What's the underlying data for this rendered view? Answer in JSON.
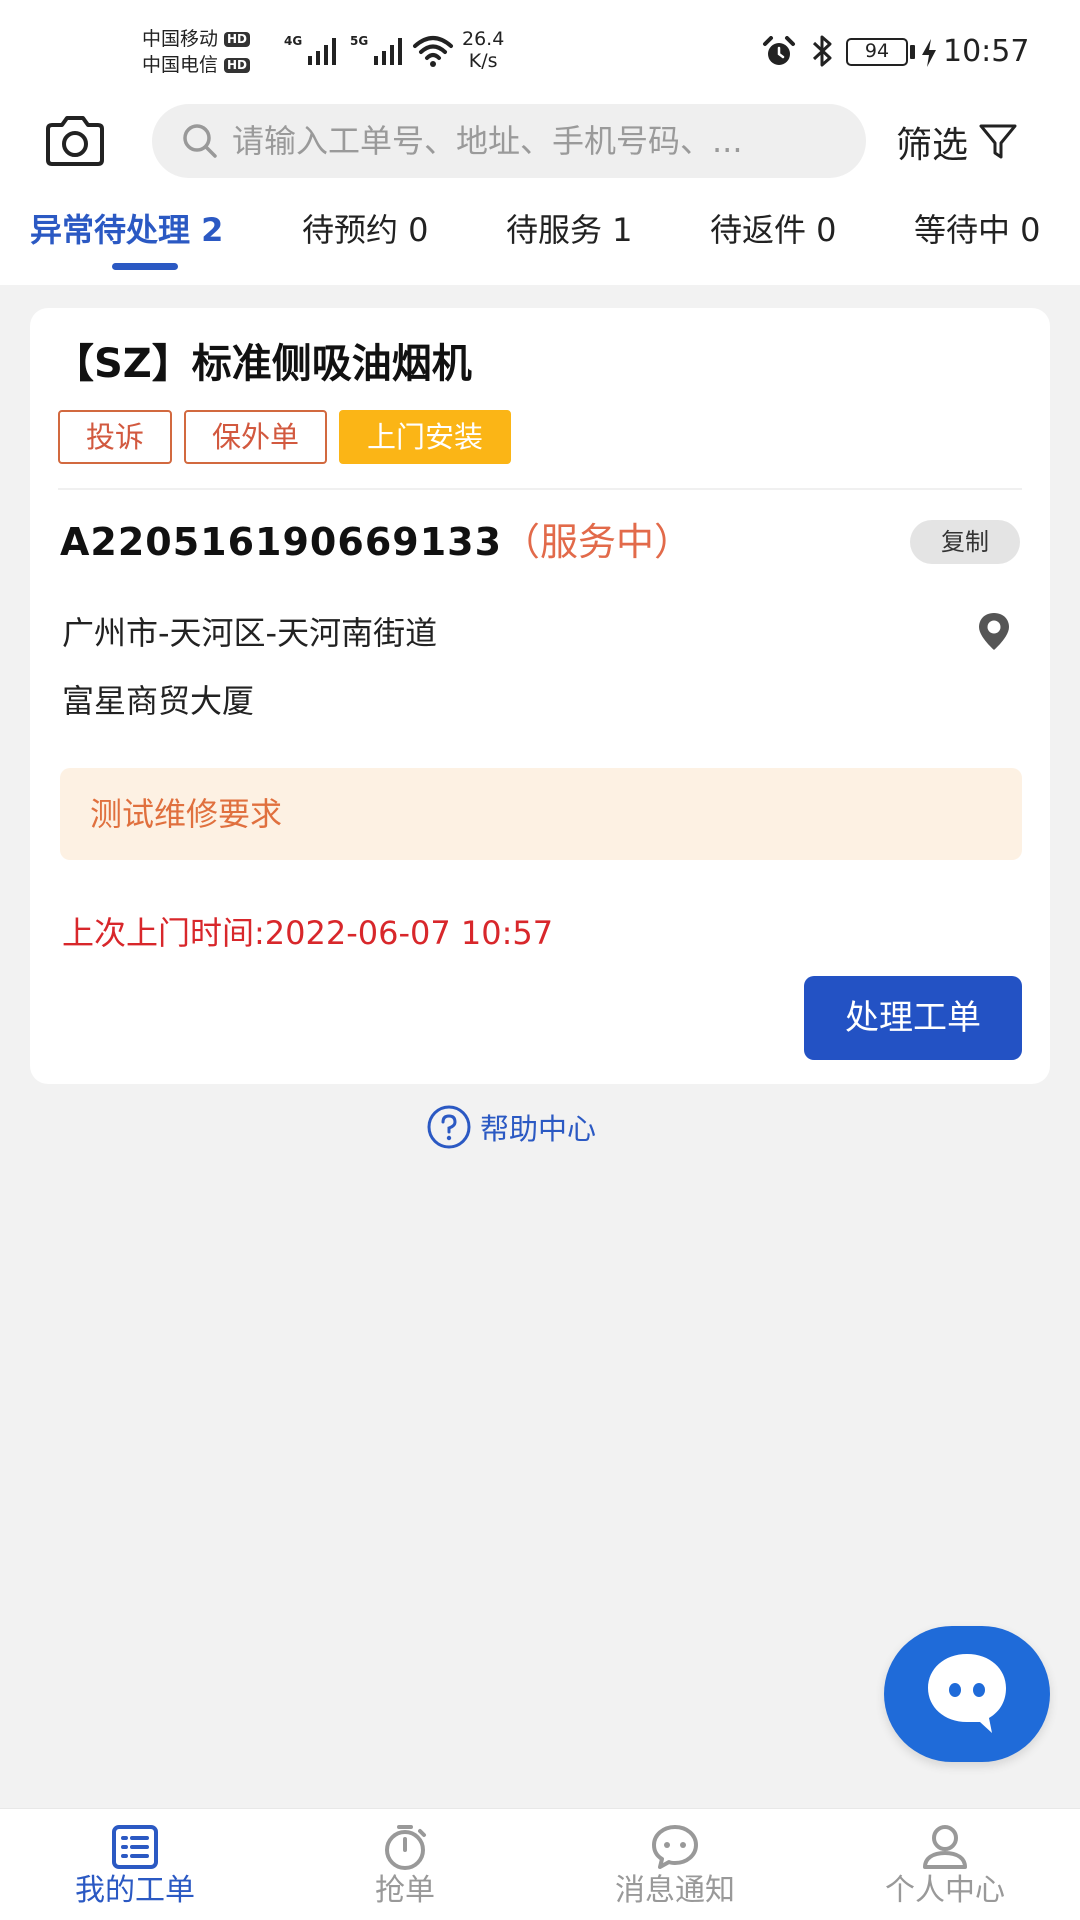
{
  "status_bar": {
    "carrier1": "中国移动",
    "carrier2": "中国电信",
    "hd": "HD",
    "sig1_label": "4G",
    "sig2_label": "5G",
    "net_speed_value": "26.4",
    "net_speed_unit": "K/s",
    "battery": "94",
    "time": "10:57"
  },
  "header": {
    "search_placeholder": "请输入工单号、地址、手机号码、...",
    "filter_label": "筛选"
  },
  "tabs": [
    {
      "label": "异常待处理 2",
      "active": true
    },
    {
      "label": "待预约 0",
      "active": false
    },
    {
      "label": "待服务 1",
      "active": false
    },
    {
      "label": "待返件 0",
      "active": false
    },
    {
      "label": "等待中 0",
      "active": false
    }
  ],
  "order_card": {
    "title": "【SZ】标准侧吸油烟机",
    "tags": [
      "投诉",
      "保外单",
      "上门安装"
    ],
    "order_no": "A220516190669133",
    "status": "（服务中）",
    "copy_label": "复制",
    "address_line1": "广州市-天河区-天河南街道",
    "address_line2": "富星商贸大厦",
    "note": "测试维修要求",
    "last_visit": "上次上门时间:2022-06-07 10:57",
    "action_label": "处理工单"
  },
  "help_label": "帮助中心",
  "bottom_nav": [
    {
      "label": "我的工单",
      "icon": "list-icon",
      "active": true
    },
    {
      "label": "抢单",
      "icon": "timer-icon",
      "active": false
    },
    {
      "label": "消息通知",
      "icon": "message-icon",
      "active": false
    },
    {
      "label": "个人中心",
      "icon": "user-icon",
      "active": false
    }
  ],
  "colors": {
    "primary": "#2352c4",
    "tab_active": "#2b59c3",
    "tag_border": "#d2693f",
    "tag_filled": "#fbb516",
    "status": "#e26a4a",
    "warning_text": "#d8272b",
    "note_bg": "#fdf1e3"
  }
}
